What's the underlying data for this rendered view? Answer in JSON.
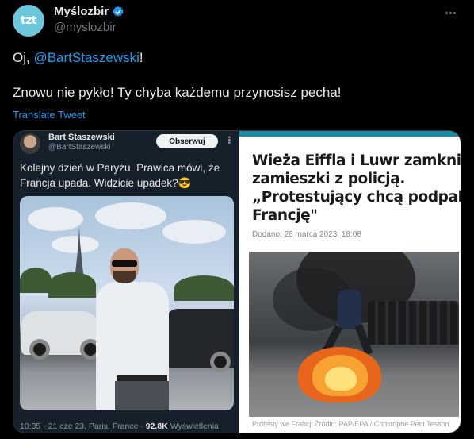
{
  "author": {
    "display_name": "Myślozbir",
    "handle": "@myslozbir",
    "avatar_text": "tzt"
  },
  "tweet": {
    "line1_prefix": "Oj, ",
    "line1_mention": "@BartStaszewski",
    "line1_suffix": "!",
    "line2": "Znowu nie pykło! Ty chyba każdemu przynosisz pecha!",
    "translate_label": "Translate Tweet"
  },
  "embedded_tweet": {
    "name": "Bart Staszewski",
    "handle": "@BartStaszewski",
    "follow_label": "Obserwuj",
    "text_line1": "Kolejny dzień w Paryżu. Prawica mówi, że",
    "text_line2": "Francja upada. Widzicie upadek?😎",
    "meta_time": "10:35 · 21 cze 23, Paris, France · ",
    "meta_views": "92.8K",
    "meta_views_label": " Wyświetlenia"
  },
  "article": {
    "headline_line1": "Wieża Eiffla i Luwr zamknięte,",
    "headline_line2": "zamieszki z policją.",
    "headline_line3": "„Protestujący chcą podpalić",
    "headline_line4": "Francję\"",
    "date": "Dodano: 28 marca 2023,   18:08",
    "caption": "Protesty we Francji Źródło: PAP/EPA / Christophe Petit Tesson"
  },
  "colors": {
    "accent": "#1d9bf0",
    "background": "#000000",
    "avatar": "#6cc6dc",
    "article_bar": "#1a8aa5"
  }
}
